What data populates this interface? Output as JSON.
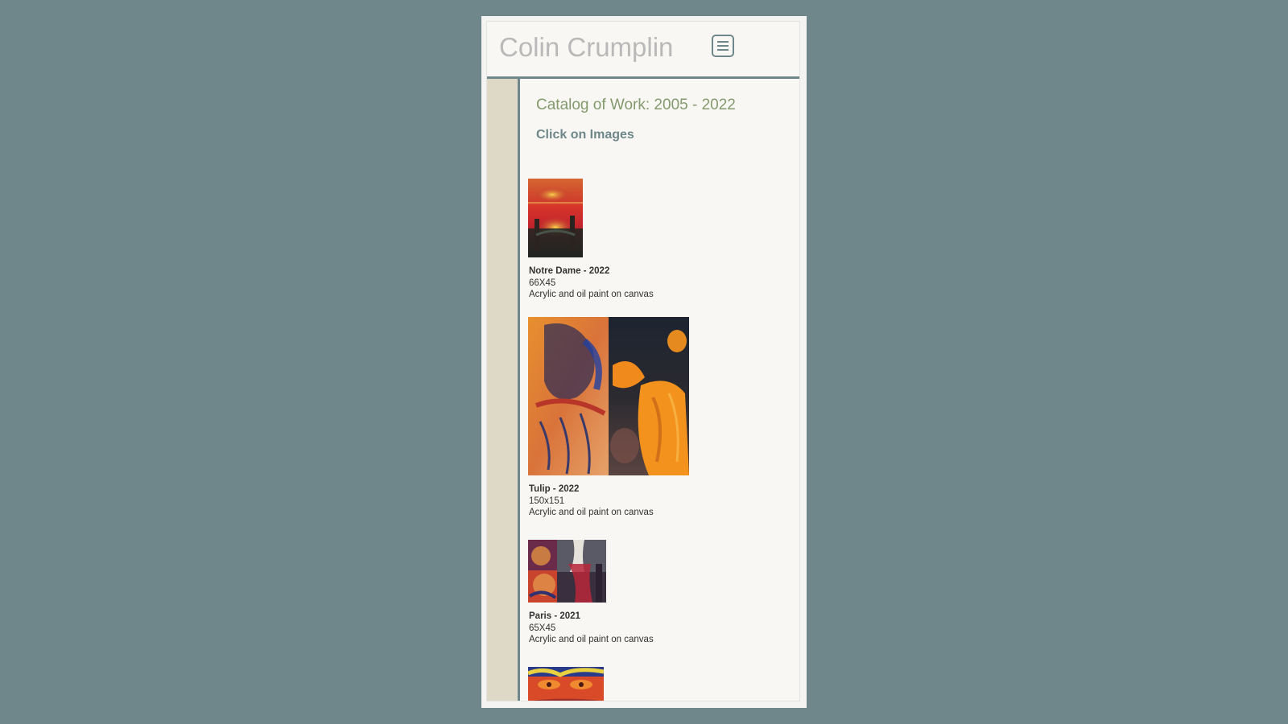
{
  "site": {
    "title": "Colin Crumplin",
    "menu_icon": "hamburger-menu-icon"
  },
  "main": {
    "heading": "Catalog of Work: 2005 - 2022",
    "instruction": "Click on Images"
  },
  "artworks": [
    {
      "title": "Notre Dame - 2022",
      "size": "66X45",
      "medium": "Acrylic and oil paint on canvas"
    },
    {
      "title": "Tulip - 2022",
      "size": "150x151",
      "medium": "Acrylic and oil paint on canvas"
    },
    {
      "title": "Paris - 2021",
      "size": "65X45",
      "medium": "Acrylic and oil paint on canvas"
    },
    {
      "title": "",
      "size": "",
      "medium": ""
    }
  ],
  "colors": {
    "background": "#6f878a",
    "accent": "#6f878a",
    "heading": "#849a6e",
    "sidebar": "#ded9c7",
    "title": "#b9b9b9"
  }
}
